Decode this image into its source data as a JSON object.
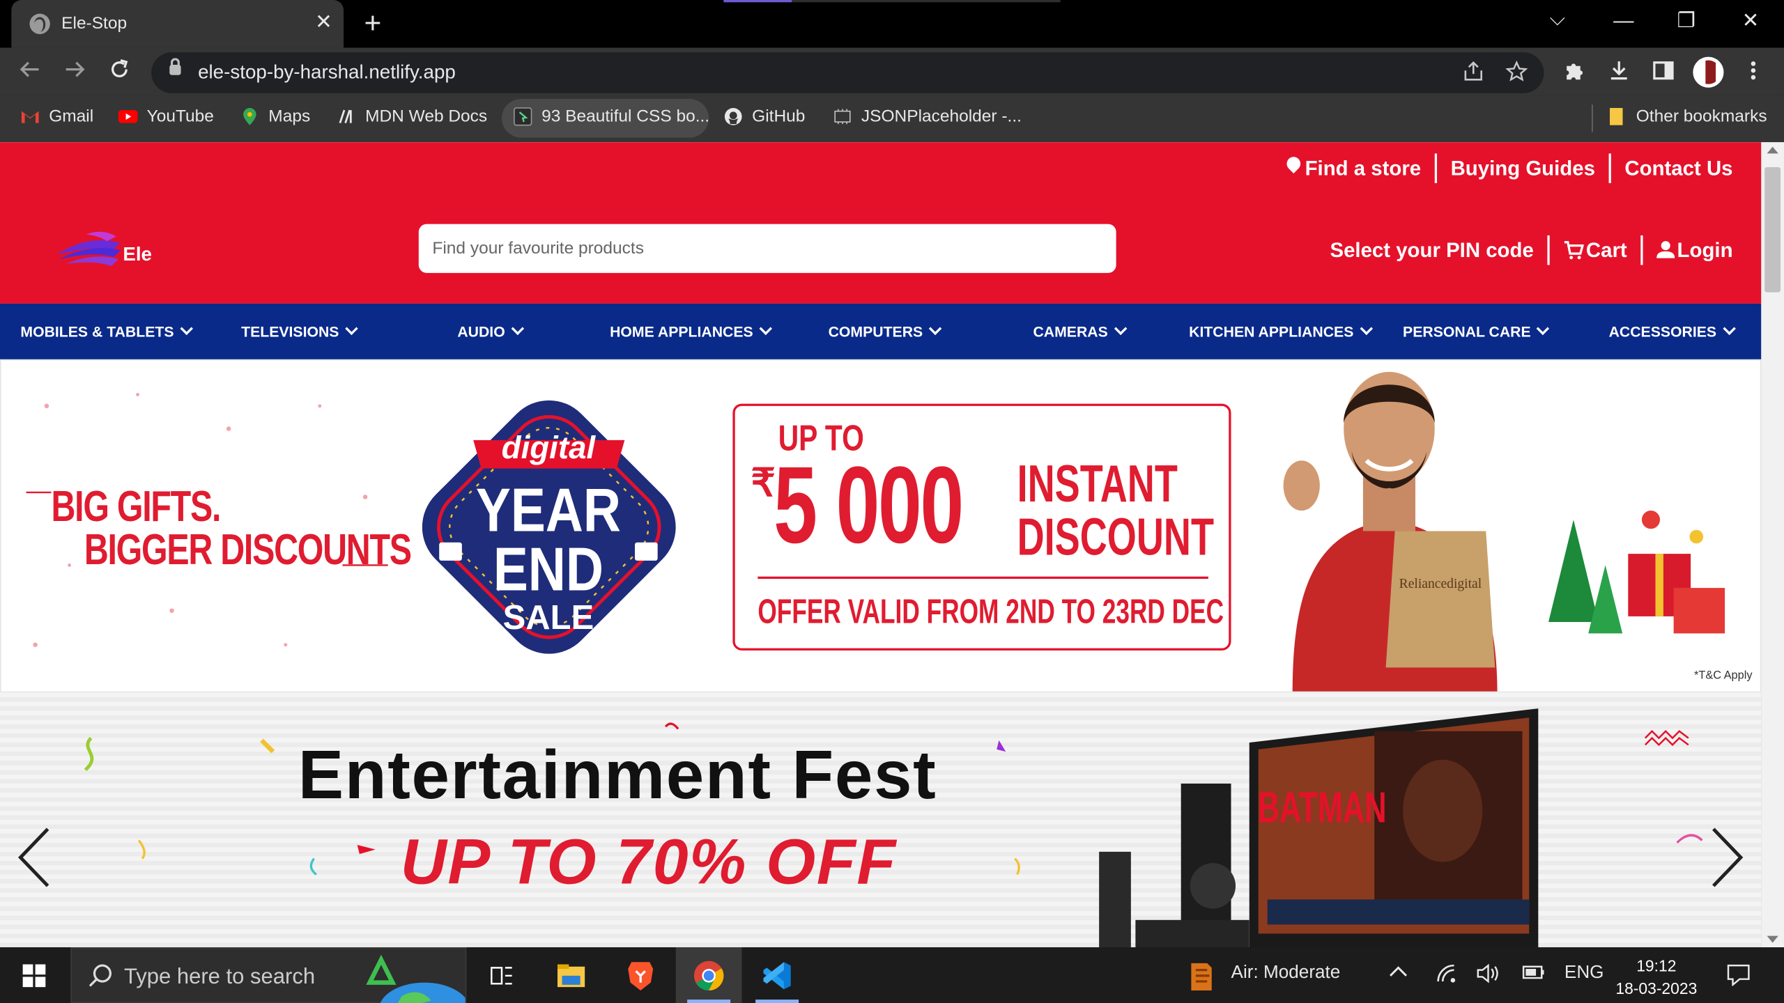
{
  "browser": {
    "tab_title": "Ele-Stop",
    "tab_close": "✕",
    "new_tab": "+",
    "url": "ele-stop-by-harshal.netlify.app",
    "window_controls": {
      "dropdown": "⌵",
      "minimize": "—",
      "restore": "❐",
      "close": "✕"
    }
  },
  "bookmarks": [
    {
      "label": "Gmail",
      "icon": "gmail-icon"
    },
    {
      "label": "YouTube",
      "icon": "youtube-icon"
    },
    {
      "label": "Maps",
      "icon": "maps-icon"
    },
    {
      "label": "MDN Web Docs",
      "icon": "mdn-icon"
    },
    {
      "label": "93 Beautiful CSS bo...",
      "icon": "css-icon"
    },
    {
      "label": "GitHub",
      "icon": "github-icon"
    },
    {
      "label": "JSONPlaceholder -...",
      "icon": "json-icon"
    }
  ],
  "other_bookmarks": "Other bookmarks",
  "site": {
    "top_links": {
      "find_store": "Find a store",
      "buying_guides": "Buying Guides",
      "contact": "Contact Us"
    },
    "logo_text": "Ele",
    "search_placeholder": "Find your favourite products",
    "right_links": {
      "pin": "Select your PIN code",
      "cart": "Cart",
      "login": "Login"
    },
    "nav": [
      "MOBILES & TABLETS",
      "TELEVISIONS",
      "AUDIO",
      "HOME APPLIANCES",
      "COMPUTERS",
      "CAMERAS",
      "KITCHEN APPLIANCES",
      "PERSONAL CARE",
      "ACCESSORIES"
    ],
    "banner1": {
      "line1": "BIG GIFTS.",
      "line2": "BIGGER DISCOUNTS",
      "badge_top": "digital",
      "badge_mid1": "YEAR",
      "badge_mid2": "END",
      "badge_bottom": "SALE",
      "upto": "UP TO",
      "rupee": "₹",
      "amount": "5 000",
      "instant": "INSTANT",
      "discount": "DISCOUNT",
      "offer": "OFFER VALID FROM 2ND TO 23RD DEC",
      "bag_text": "Reliancedigital",
      "tc": "*T&C Apply"
    },
    "banner2": {
      "title": "Entertainment Fest",
      "offer": "UP TO 70% OFF",
      "tv_text": "BATMAN",
      "prev": "‹",
      "next": "›"
    }
  },
  "taskbar": {
    "search_placeholder": "Type here to search",
    "weather": "Air: Moderate",
    "language": "ENG",
    "time": "19:12",
    "date": "18-03-2023"
  },
  "colors": {
    "brand_red": "#e5112b",
    "nav_blue": "#0a2a8a"
  }
}
